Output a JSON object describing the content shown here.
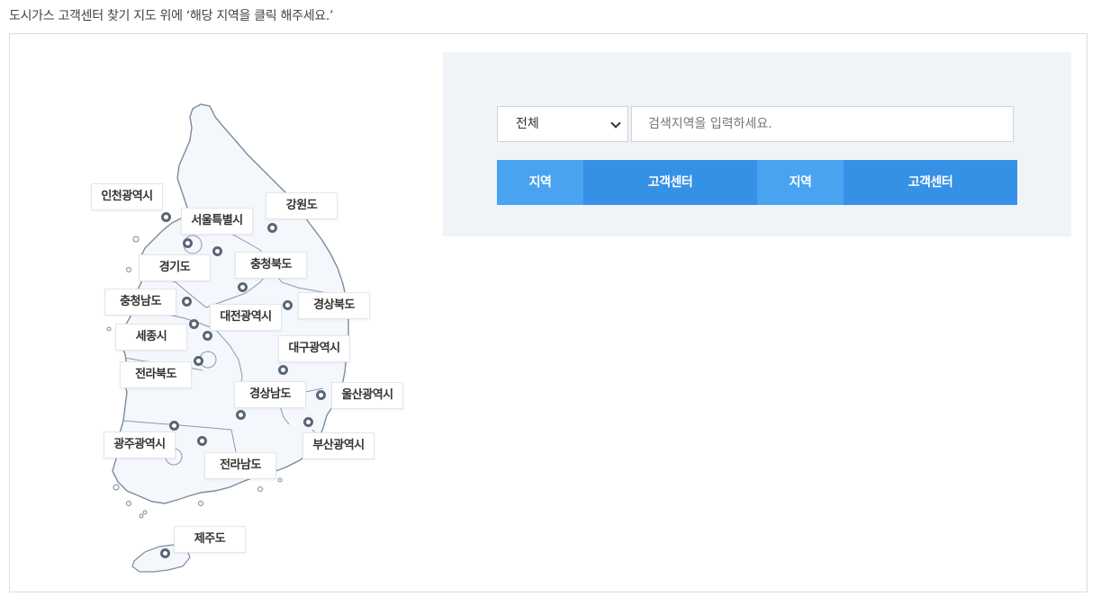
{
  "guide_text": "도시가스 고객센터 찾기 지도 위에 ‘해당 지역을 클릭 해주세요.’",
  "colors": {
    "map_fill": "#f4f7fb",
    "map_stroke": "#7d8b9b",
    "pin": "#5a6677",
    "panel_bg": "#f0f3f7",
    "header_light": "#4aa3f0",
    "header_dark": "#3591e6"
  },
  "regions": [
    {
      "name": "인천광역시"
    },
    {
      "name": "서울특별시"
    },
    {
      "name": "강원도"
    },
    {
      "name": "경기도"
    },
    {
      "name": "충청북도"
    },
    {
      "name": "충청남도"
    },
    {
      "name": "대전광역시"
    },
    {
      "name": "경상북도"
    },
    {
      "name": "세종시"
    },
    {
      "name": "대구광역시"
    },
    {
      "name": "전라북도"
    },
    {
      "name": "경상남도"
    },
    {
      "name": "울산광역시"
    },
    {
      "name": "광주광역시"
    },
    {
      "name": "부산광역시"
    },
    {
      "name": "전라남도"
    },
    {
      "name": "제주도"
    }
  ],
  "search": {
    "select_value": "전체",
    "placeholder": "검색지역을 입력하세요."
  },
  "table_header": [
    "지역",
    "고객센터",
    "지역",
    "고객센터"
  ]
}
